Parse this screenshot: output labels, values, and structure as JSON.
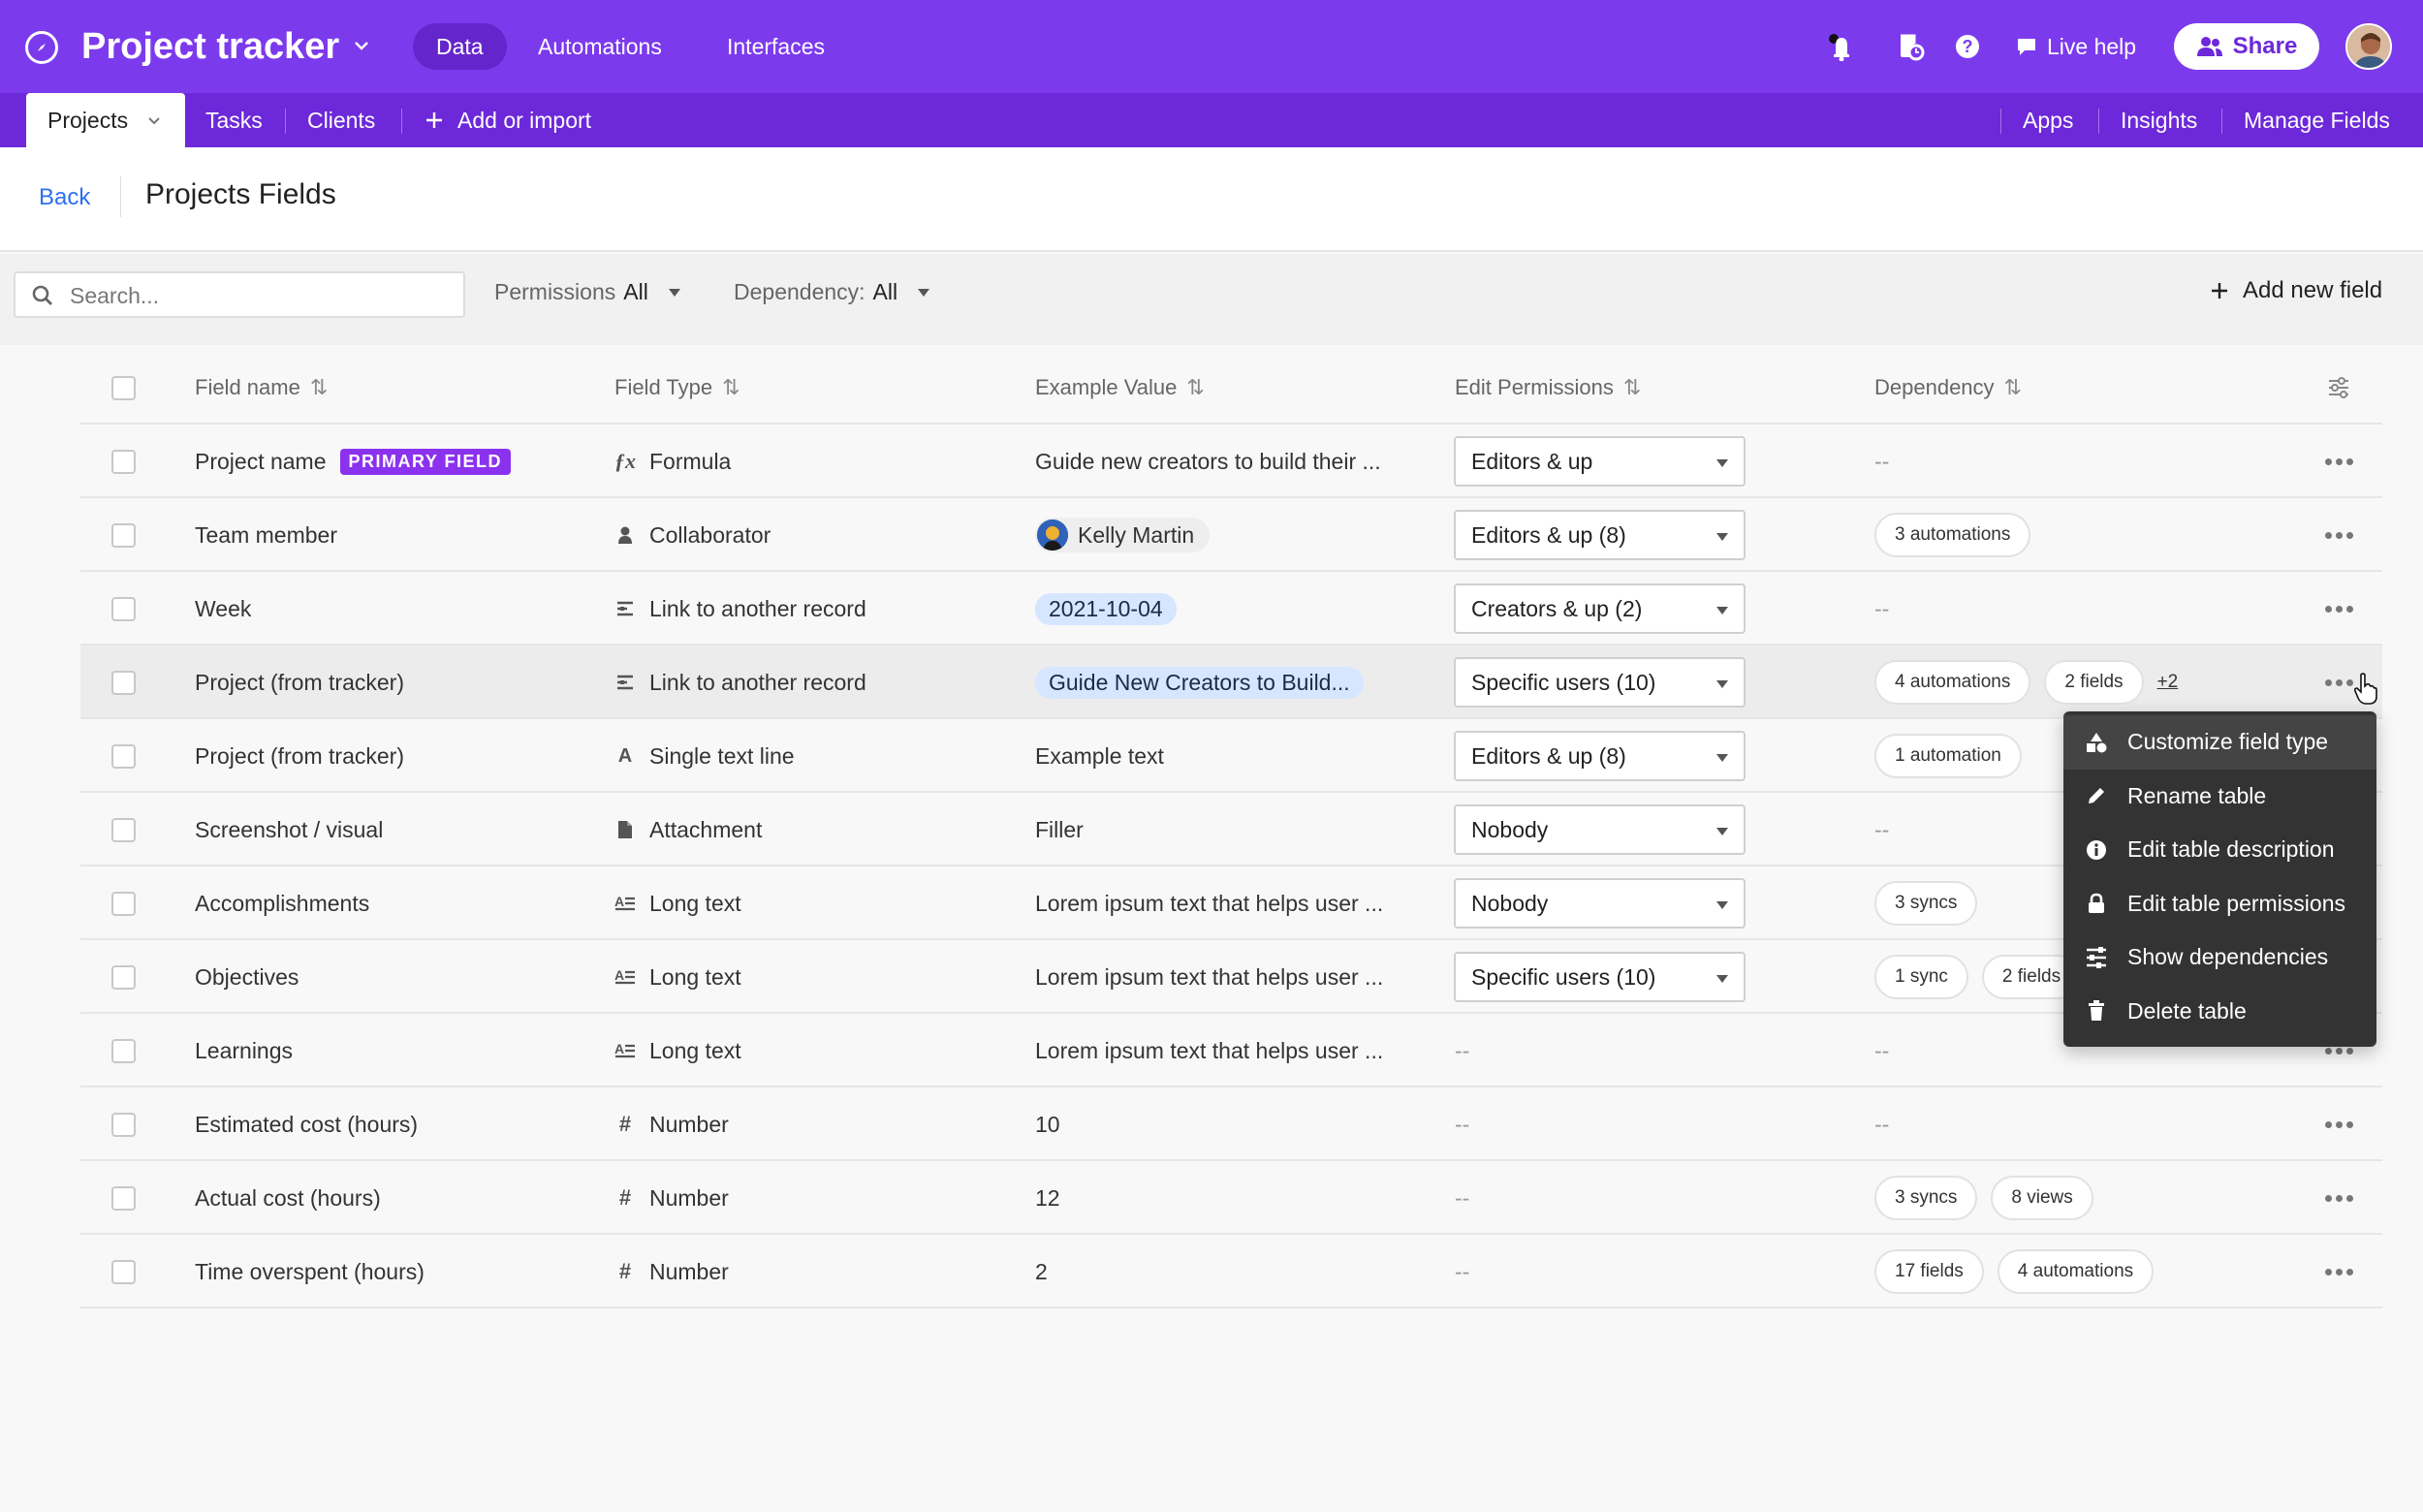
{
  "app": {
    "title": "Project tracker"
  },
  "nav": {
    "data": "Data",
    "automations": "Automations",
    "interfaces": "Interfaces"
  },
  "topbar": {
    "live_help": "Live help",
    "share": "Share"
  },
  "tabs": {
    "projects": "Projects",
    "tasks": "Tasks",
    "clients": "Clients",
    "add": "Add or import",
    "apps": "Apps",
    "insights": "Insights",
    "manage": "Manage Fields"
  },
  "header": {
    "back": "Back",
    "title": "Projects Fields"
  },
  "toolbar": {
    "search_placeholder": "Search...",
    "permissions_label": "Permissions",
    "permissions_value": "All",
    "dependency_label": "Dependency:",
    "dependency_value": "All",
    "add_field": "Add new field"
  },
  "columns": {
    "field_name": "Field name",
    "field_type": "Field Type",
    "example": "Example Value",
    "permissions": "Edit Permissions",
    "dependency": "Dependency"
  },
  "primary_badge": "PRIMARY FIELD",
  "rows": [
    {
      "name": "Project name",
      "type": "Formula",
      "type_icon": "formula-icon",
      "example": "Guide new creators to build their ...",
      "example_style": "text",
      "permission": "Editors & up",
      "deps": [],
      "dep_empty": "--"
    },
    {
      "name": "Team member",
      "type": "Collaborator",
      "type_icon": "person-icon",
      "example": "Kelly Martin",
      "example_style": "user",
      "permission": "Editors & up (8)",
      "deps": [
        "3 automations"
      ],
      "dep_empty": ""
    },
    {
      "name": "Week",
      "type": "Link to another record",
      "type_icon": "link-record-icon",
      "example": "2021-10-04",
      "example_style": "pill",
      "permission": "Creators & up (2)",
      "deps": [],
      "dep_empty": "--"
    },
    {
      "name": "Project (from tracker)",
      "type": "Link to another record",
      "type_icon": "link-record-icon",
      "example": "Guide New Creators to Build...",
      "example_style": "pill",
      "permission": "Specific users (10)",
      "deps": [
        "4 automations",
        "2 fields"
      ],
      "dep_more": "+2",
      "dep_empty": ""
    },
    {
      "name": "Project (from tracker)",
      "type": "Single text line",
      "type_icon": "text-icon",
      "example": "Example text",
      "example_style": "text",
      "permission": "Editors & up (8)",
      "deps": [
        "1 automation"
      ],
      "dep_empty": ""
    },
    {
      "name": "Screenshot / visual",
      "type": "Attachment",
      "type_icon": "attachment-icon",
      "example": "Filler",
      "example_style": "text",
      "permission": "Nobody",
      "deps": [],
      "dep_empty": "--"
    },
    {
      "name": "Accomplishments",
      "type": "Long text",
      "type_icon": "long-text-icon",
      "example": "Lorem ipsum text that helps user ...",
      "example_style": "text",
      "permission": "Nobody",
      "deps": [
        "3 syncs"
      ],
      "dep_empty": ""
    },
    {
      "name": "Objectives",
      "type": "Long text",
      "type_icon": "long-text-icon",
      "example": "Lorem ipsum text that helps user ...",
      "example_style": "text",
      "permission": "Specific users (10)",
      "deps": [
        "1 sync",
        "2 fields"
      ],
      "dep_empty": ""
    },
    {
      "name": "Learnings",
      "type": "Long text",
      "type_icon": "long-text-icon",
      "example": "Lorem ipsum text that helps user ...",
      "example_style": "text",
      "permission": "--",
      "deps": [],
      "dep_empty": "--"
    },
    {
      "name": "Estimated cost (hours)",
      "type": "Number",
      "type_icon": "number-icon",
      "example": "10",
      "example_style": "text",
      "permission": "--",
      "deps": [],
      "dep_empty": "--"
    },
    {
      "name": "Actual cost (hours)",
      "type": "Number",
      "type_icon": "number-icon",
      "example": "12",
      "example_style": "text",
      "permission": "--",
      "deps": [
        "3 syncs",
        "8 views"
      ],
      "dep_empty": ""
    },
    {
      "name": "Time overspent (hours)",
      "type": "Number",
      "type_icon": "number-icon",
      "example": "2",
      "example_style": "text",
      "permission": "--",
      "deps": [
        "17 fields",
        "4 automations"
      ],
      "dep_empty": ""
    }
  ],
  "menu": [
    {
      "label": "Customize field type",
      "icon": "shapes-icon"
    },
    {
      "label": "Rename table",
      "icon": "pencil-icon"
    },
    {
      "label": "Edit table description",
      "icon": "info-icon"
    },
    {
      "label": "Edit table permissions",
      "icon": "lock-icon"
    },
    {
      "label": "Show dependencies",
      "icon": "dependencies-icon"
    },
    {
      "label": "Delete table",
      "icon": "trash-icon"
    }
  ],
  "colors": {
    "brand": "#7c3aed",
    "brand_dark": "#6d28d9",
    "badge": "#8b32ef",
    "link": "#2d6ff0",
    "pill_blue": "#d6e6ff",
    "menu_bg": "#333333"
  }
}
